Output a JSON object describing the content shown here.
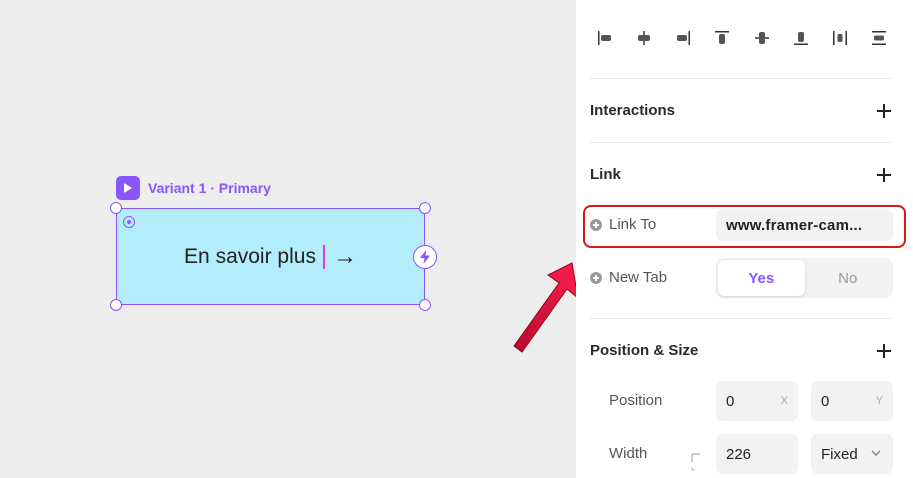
{
  "canvas": {
    "variant_label": "Variant 1 · Primary",
    "button_text": "En savoir plus",
    "arrow_glyph": "→",
    "accent": "#8855ff",
    "frame_fill": "#b3ecfb"
  },
  "annotation": {
    "arrow_color": "#e6123d",
    "highlight_color": "#d9161c"
  },
  "panel": {
    "alignment_icons": [
      "align-left-icon",
      "align-center-horizontal-icon",
      "align-right-icon",
      "align-top-icon",
      "align-center-vertical-icon",
      "align-bottom-icon",
      "distribute-horizontal-icon",
      "distribute-vertical-icon"
    ],
    "interactions": {
      "title": "Interactions"
    },
    "link": {
      "title": "Link",
      "link_to_label": "Link To",
      "link_to_value": "www.framer-cam...",
      "new_tab_label": "New Tab",
      "new_tab_options": [
        "Yes",
        "No"
      ],
      "new_tab_selected": "Yes"
    },
    "position_size": {
      "title": "Position & Size",
      "position_label": "Position",
      "x_value": "0",
      "x_suffix": "X",
      "y_value": "0",
      "y_suffix": "Y",
      "width_label": "Width",
      "width_value": "226",
      "width_mode": "Fixed"
    }
  }
}
